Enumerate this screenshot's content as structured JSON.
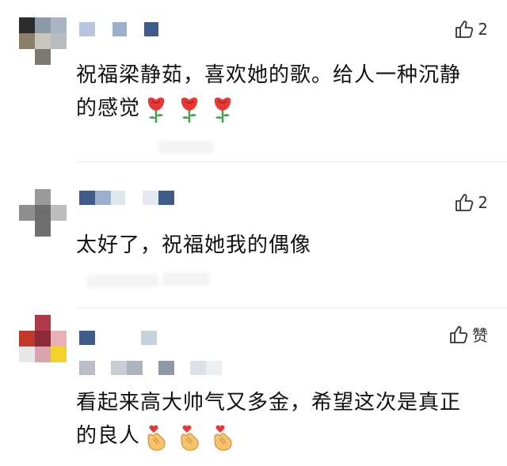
{
  "comments": [
    {
      "like_label": "2",
      "text": "祝福梁静茹，喜欢她的歌。给人一种沉静的感觉",
      "emojis": [
        "rose-emoji",
        "rose-emoji",
        "rose-emoji"
      ]
    },
    {
      "like_label": "2",
      "text": "太好了，祝福她我的偶像",
      "emojis": []
    },
    {
      "like_label": "赞",
      "text": "看起来高大帅气又多金，希望这次是真正的良人",
      "emojis": [
        "finger-heart-emoji",
        "finger-heart-emoji",
        "finger-heart-emoji"
      ]
    }
  ],
  "icons": {
    "like": "thumbs-up-icon"
  },
  "colors": {
    "text": "#111111",
    "like_text": "#333333",
    "mosaic_blue": "#3d5c8a",
    "rose_red": "#e53935",
    "stem_green": "#43a047",
    "hand_yellow": "#f6c26b",
    "heart_red": "#e53935"
  }
}
